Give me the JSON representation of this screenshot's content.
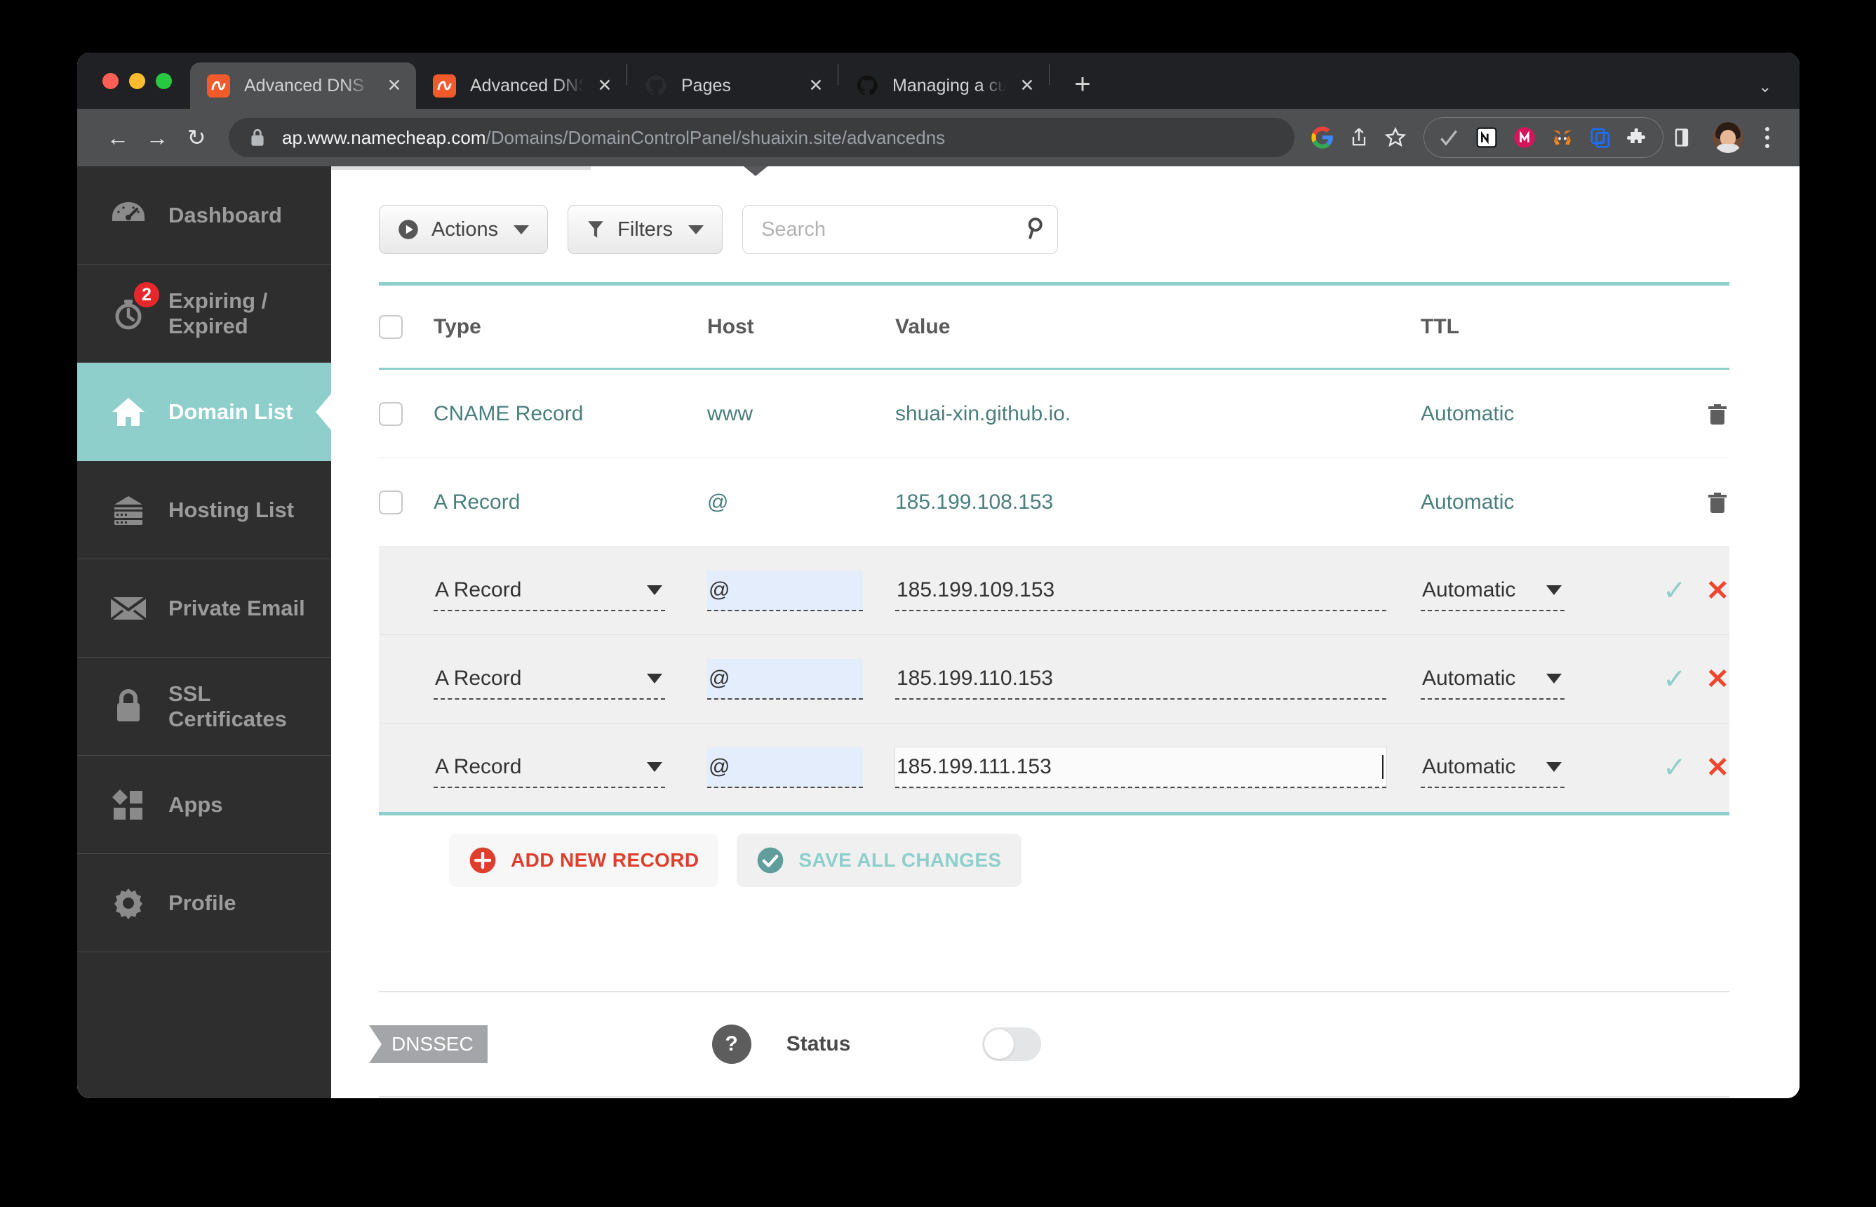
{
  "browser": {
    "tabs": [
      {
        "title": "Advanced DNS",
        "favicon": "namecheap-icon",
        "active": true
      },
      {
        "title": "Advanced DNS",
        "favicon": "namecheap-icon",
        "active": false
      },
      {
        "title": "Pages",
        "favicon": "github-icon",
        "active": false
      },
      {
        "title": "Managing a custom domain for",
        "favicon": "github-icon",
        "active": false
      }
    ],
    "new_tab_label": "+",
    "tab_close_label": "✕",
    "window_menu_label": "⌄",
    "nav": {
      "back": "←",
      "forward": "→",
      "reload": "↻"
    },
    "url_host": "ap.www.namecheap.com",
    "url_path": "/Domains/DomainControlPanel/shuaixin.site/advancedns",
    "omnibox_icons": [
      "google-icon",
      "share-icon",
      "bookmark-star-icon"
    ],
    "extension_icons": [
      "checkmark-extension-icon",
      "notion-extension-icon",
      "monica-extension-icon",
      "metamask-extension-icon",
      "4everland-extension-icon",
      "puzzle-extensions-icon"
    ],
    "side_panel_icon": "side-panel-icon",
    "profile_icon": "avatar",
    "menu_icon": "three-dot-menu-icon"
  },
  "sidebar": {
    "items": [
      {
        "label": "Dashboard",
        "icon": "speedometer-icon",
        "active": false,
        "badge": null
      },
      {
        "label": "Expiring / Expired",
        "icon": "stopwatch-icon",
        "active": false,
        "badge": "2"
      },
      {
        "label": "Domain List",
        "icon": "house-icon",
        "active": true,
        "badge": null
      },
      {
        "label": "Hosting List",
        "icon": "server-icon",
        "active": false,
        "badge": null
      },
      {
        "label": "Private Email",
        "icon": "envelope-icon",
        "active": false,
        "badge": null
      },
      {
        "label": "SSL Certificates",
        "icon": "lock-icon",
        "active": false,
        "badge": null
      },
      {
        "label": "Apps",
        "icon": "apps-grid-icon",
        "active": false,
        "badge": null
      },
      {
        "label": "Profile",
        "icon": "gear-icon",
        "active": false,
        "badge": null
      }
    ]
  },
  "toolbar": {
    "actions_label": "Actions",
    "filters_label": "Filters",
    "search_placeholder": "Search",
    "search_value": ""
  },
  "table": {
    "columns": [
      "Type",
      "Host",
      "Value",
      "TTL"
    ],
    "rows": [
      {
        "mode": "static",
        "type": "CNAME Record",
        "host": "www",
        "value": "shuai-xin.github.io.",
        "ttl": "Automatic",
        "action": "delete-record-button"
      },
      {
        "mode": "static",
        "type": "A Record",
        "host": "@",
        "value": "185.199.108.153",
        "ttl": "Automatic",
        "action": "delete-record-button"
      },
      {
        "mode": "edit",
        "type": "A Record",
        "host": "@",
        "value": "185.199.109.153",
        "ttl": "Automatic",
        "focused": false
      },
      {
        "mode": "edit",
        "type": "A Record",
        "host": "@",
        "value": "185.199.110.153",
        "ttl": "Automatic",
        "focused": false
      },
      {
        "mode": "edit",
        "type": "A Record",
        "host": "@",
        "value": "185.199.111.153",
        "ttl": "Automatic",
        "focused": true
      }
    ],
    "confirm_label": "✓",
    "cancel_label": "✕"
  },
  "record_actions": {
    "add_label": "ADD NEW RECORD",
    "save_label": "SAVE ALL CHANGES"
  },
  "dnssec": {
    "tag_label": "DNSSEC",
    "help_label": "?",
    "status_label": "Status",
    "toggle_on": false
  },
  "colors": {
    "accent_teal": "#8ecfcb",
    "link_teal": "#4a7f7c",
    "danger_red": "#e03e2d",
    "badge_red": "#e8272c",
    "sidebar_bg": "#2e2e2e",
    "row_edit_bg": "#f0f0f0",
    "host_field_bg": "#e4edfb"
  }
}
